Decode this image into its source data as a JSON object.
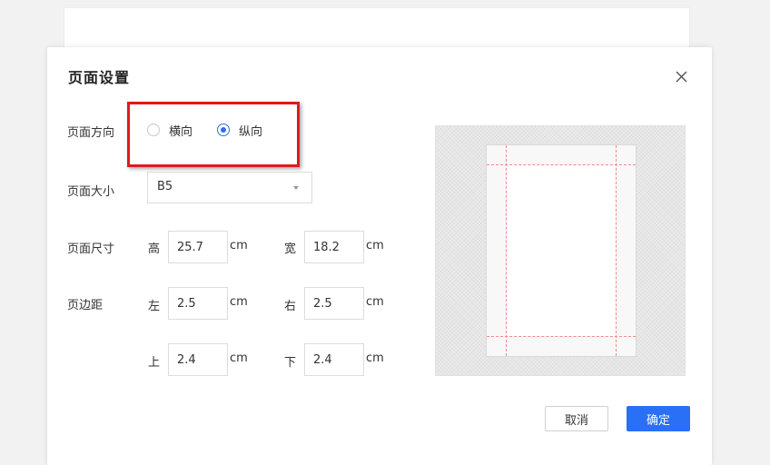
{
  "dialog": {
    "title": "页面设置",
    "close_icon": "close-icon"
  },
  "orientation": {
    "label": "页面方向",
    "options": [
      "横向",
      "纵向"
    ],
    "selected": "纵向"
  },
  "page_size": {
    "label": "页面大小",
    "value": "B5"
  },
  "dimensions": {
    "label": "页面尺寸",
    "height_label": "高",
    "height_value": "25.7",
    "width_label": "宽",
    "width_value": "18.2",
    "unit": "cm"
  },
  "margins": {
    "label": "页边距",
    "left_label": "左",
    "left_value": "2.5",
    "right_label": "右",
    "right_value": "2.5",
    "top_label": "上",
    "top_value": "2.4",
    "bottom_label": "下",
    "bottom_value": "2.4",
    "unit": "cm"
  },
  "buttons": {
    "cancel": "取消",
    "ok": "确定"
  },
  "colors": {
    "accent": "#2970f6",
    "highlight": "#e01a1a",
    "guide": "#f08a8a"
  }
}
